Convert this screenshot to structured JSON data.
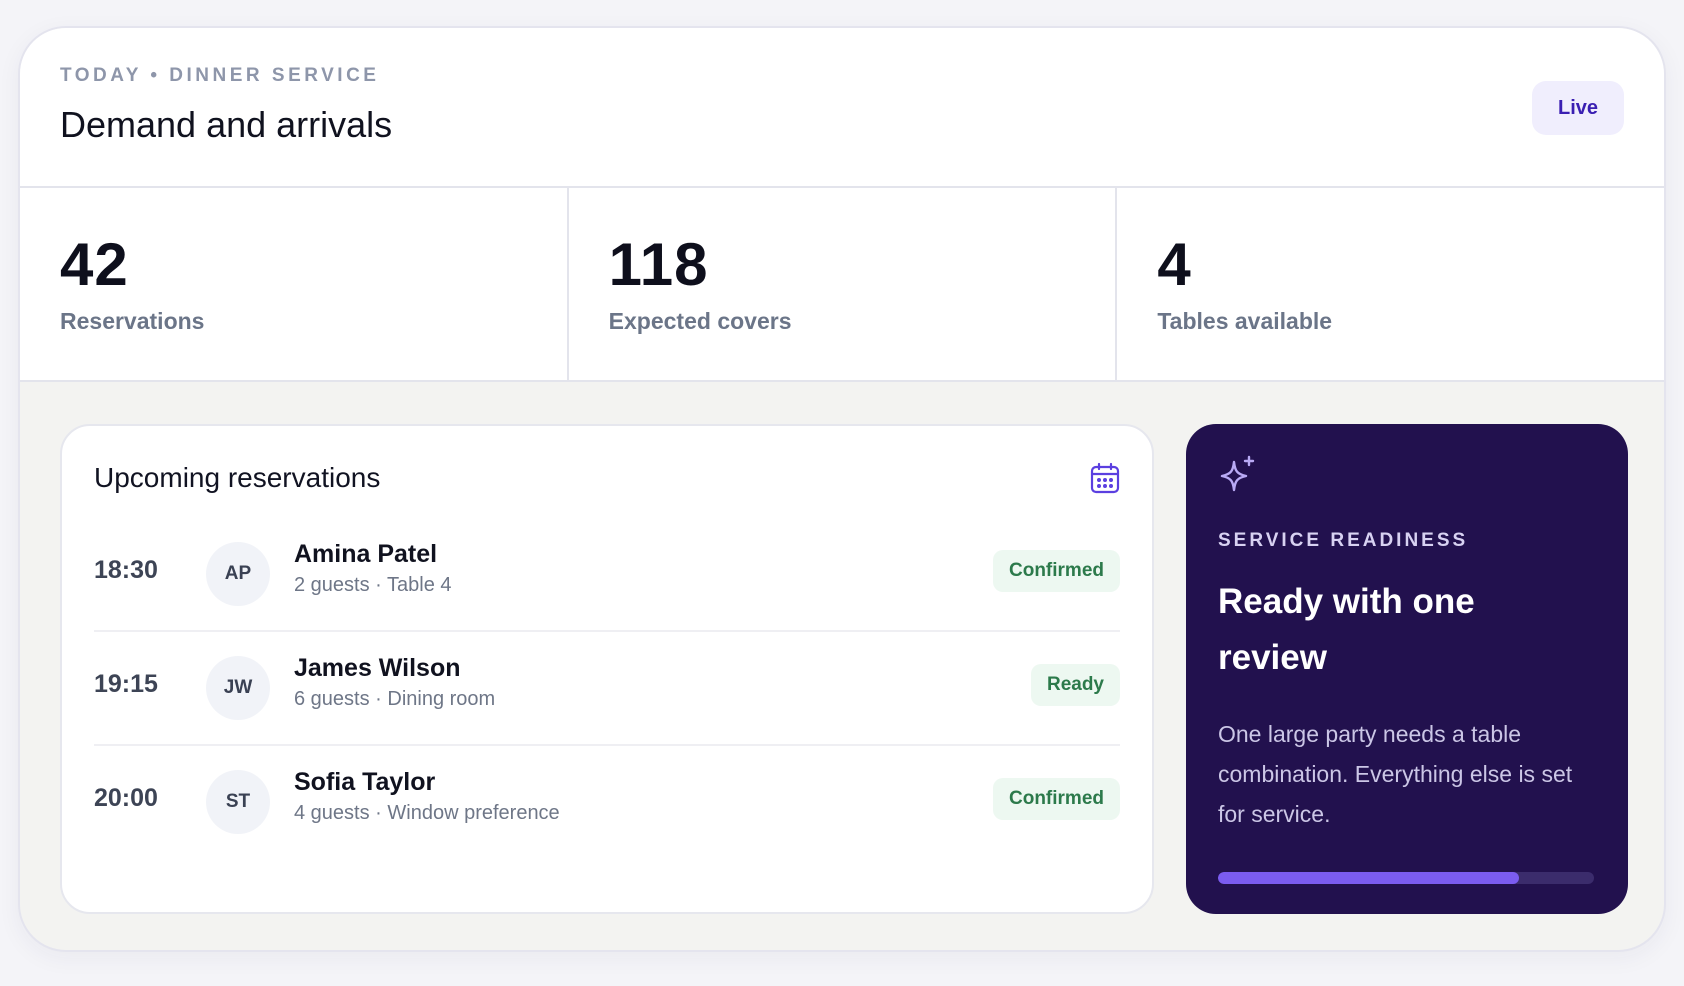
{
  "header": {
    "eyebrow": "TODAY • DINNER SERVICE",
    "title": "Demand and arrivals",
    "live_label": "Live"
  },
  "stats": [
    {
      "value": "42",
      "label": "Reservations"
    },
    {
      "value": "118",
      "label": "Expected covers"
    },
    {
      "value": "4",
      "label": "Tables available"
    }
  ],
  "upcoming": {
    "title": "Upcoming reservations",
    "icon": "calendar-icon",
    "rows": [
      {
        "time": "18:30",
        "initials": "AP",
        "name": "Amina Patel",
        "detail": "2 guests · Table 4",
        "status": "Confirmed"
      },
      {
        "time": "19:15",
        "initials": "JW",
        "name": "James Wilson",
        "detail": "6 guests · Dining room",
        "status": "Ready"
      },
      {
        "time": "20:00",
        "initials": "ST",
        "name": "Sofia Taylor",
        "detail": "4 guests · Window preference",
        "status": "Confirmed"
      }
    ]
  },
  "readiness": {
    "icon": "sparkle-icon",
    "eyebrow": "SERVICE READINESS",
    "title": "Ready with one review",
    "description": "One large party needs a table combination. Everything else is set for service.",
    "progress_percent": 80
  },
  "colors": {
    "accent": "#7b5cf0",
    "side_background": "#22114e",
    "status_green": "#2c7a4b"
  }
}
